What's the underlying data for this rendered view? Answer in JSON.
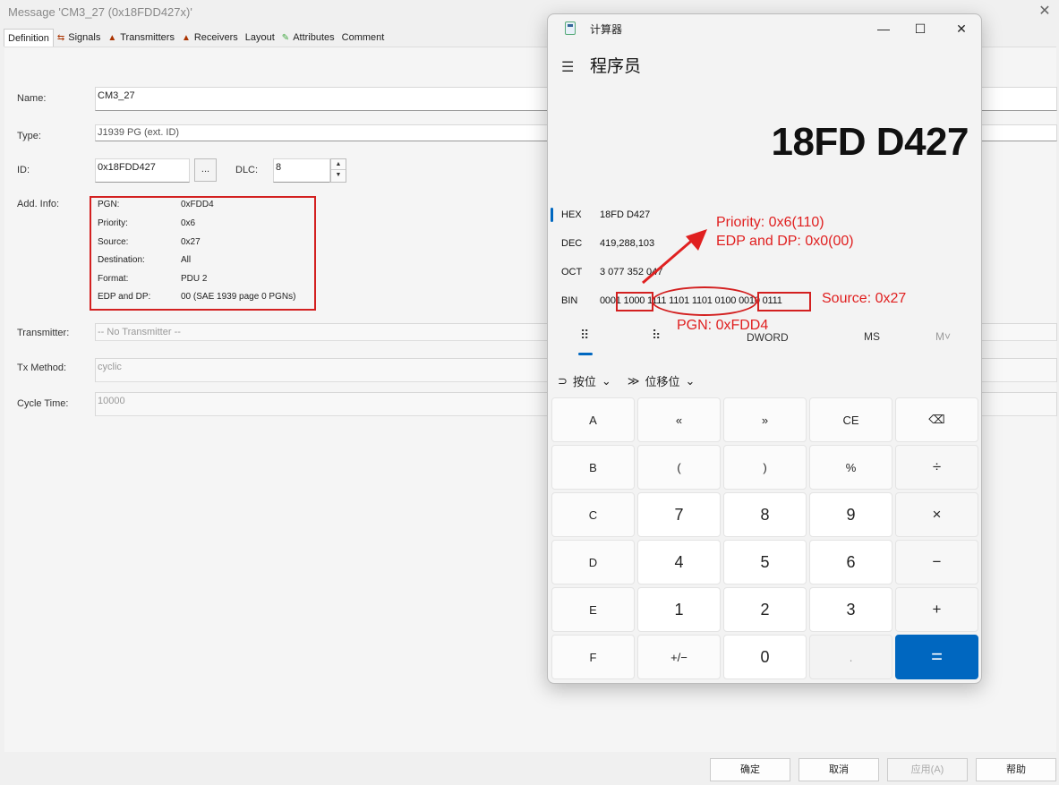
{
  "dialog": {
    "title": "Message 'CM3_27 (0x18FDD427x)'",
    "close_glyph": "✕",
    "tabs": [
      {
        "label": "Definition",
        "icon": ""
      },
      {
        "label": "Signals",
        "icon": "signals-icon"
      },
      {
        "label": "Transmitters",
        "icon": "transmitters-icon"
      },
      {
        "label": "Receivers",
        "icon": "receivers-icon"
      },
      {
        "label": "Layout",
        "icon": ""
      },
      {
        "label": "Attributes",
        "icon": "attributes-icon"
      },
      {
        "label": "Comment",
        "icon": ""
      }
    ],
    "name_label": "Name:",
    "name_value": "CM3_27",
    "type_label": "Type:",
    "type_value": "J1939 PG (ext. ID)",
    "id_label": "ID:",
    "id_value": "0x18FDD427",
    "dots_label": "...",
    "dlc_label": "DLC:",
    "dlc_value": "8",
    "addinfo_label": "Add. Info:",
    "addinfo": [
      {
        "key": "PGN:",
        "value": "0xFDD4"
      },
      {
        "key": "Priority:",
        "value": "0x6"
      },
      {
        "key": "Source:",
        "value": "0x27"
      },
      {
        "key": "Destination:",
        "value": "All"
      },
      {
        "key": "Format:",
        "value": "PDU 2"
      },
      {
        "key": "EDP and DP:",
        "value": "00 (SAE 1939 page 0 PGNs)"
      }
    ],
    "transmitter_label": "Transmitter:",
    "transmitter_value": "-- No Transmitter --",
    "txmethod_label": "Tx Method:",
    "txmethod_value": "cyclic",
    "cycletime_label": "Cycle Time:",
    "cycletime_value": "10000",
    "buttons": {
      "ok": "确定",
      "cancel": "取消",
      "apply": "应用(A)",
      "help": "帮助"
    }
  },
  "calculator": {
    "title": "计算器",
    "mode": "程序员",
    "display": "18FD D427",
    "min_glyph": "—",
    "max_glyph": "☐",
    "close_glyph": "✕",
    "menu_glyph": "☰",
    "bases": [
      {
        "name": "HEX",
        "value": "18FD D427"
      },
      {
        "name": "DEC",
        "value": "419,288,103"
      },
      {
        "name": "OCT",
        "value": "3 077 352 047"
      },
      {
        "name": "BIN",
        "value": "0001 1000 1111 1101 1101 0100 0010 0111"
      }
    ],
    "modebar": {
      "keypad": "⠿",
      "bitflip": "⠷",
      "word": "DWORD",
      "ms": "MS",
      "mv": "M˅"
    },
    "ops": {
      "bitwise": "按位",
      "shift": "位移位"
    },
    "keys": [
      [
        "A",
        "«",
        "»",
        "CE",
        "⌫"
      ],
      [
        "B",
        "(",
        ")",
        "%",
        "÷"
      ],
      [
        "C",
        "7",
        "8",
        "9",
        "×"
      ],
      [
        "D",
        "4",
        "5",
        "6",
        "−"
      ],
      [
        "E",
        "1",
        "2",
        "3",
        "+"
      ],
      [
        "F",
        "+/−",
        "0",
        ".",
        "="
      ]
    ],
    "accent": "#0067c0"
  },
  "annotations": {
    "priority": "Priority: 0x6(110)",
    "edp": "EDP and DP: 0x0(00)",
    "source": "Source: 0x27",
    "pgn": "PGN: 0xFDD4",
    "color": "#e02020"
  }
}
